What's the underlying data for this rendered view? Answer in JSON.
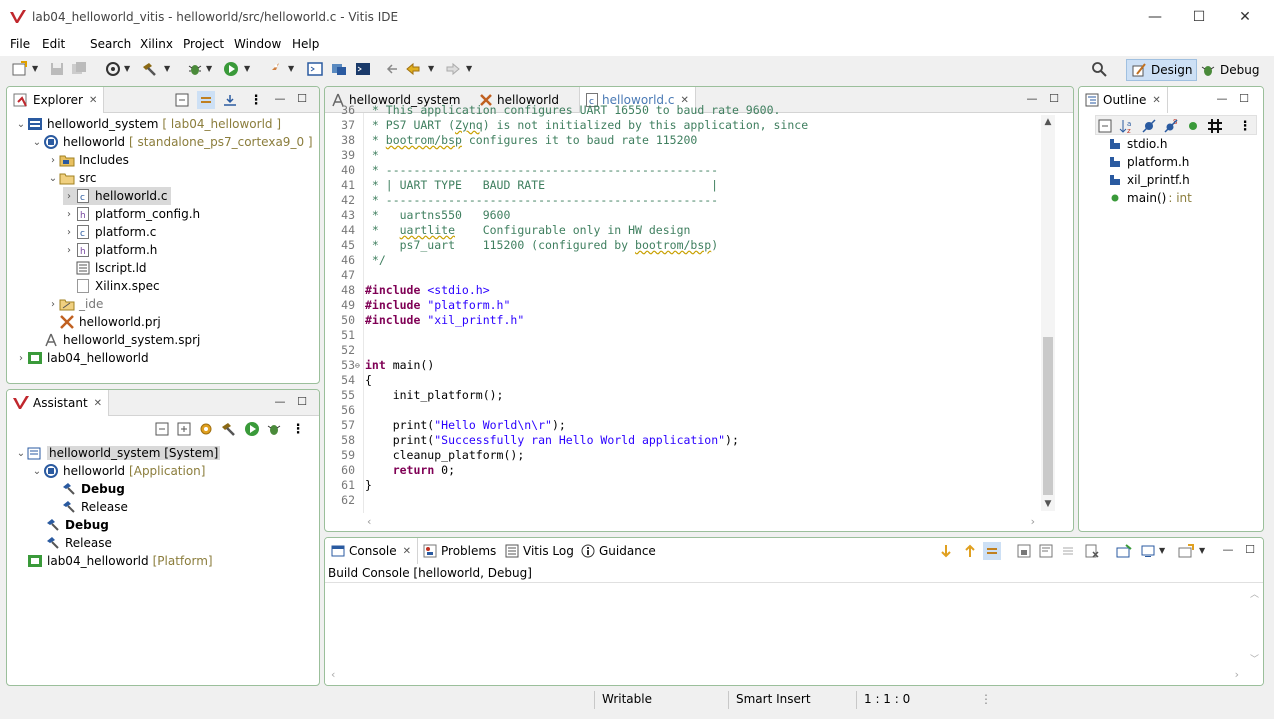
{
  "window": {
    "title": "lab04_helloworld_vitis - helloworld/src/helloworld.c - Vitis IDE",
    "minimize": "—",
    "maximize": "☐",
    "close": "✕"
  },
  "menu": [
    "File",
    "Edit",
    "Search",
    "Xilinx",
    "Project",
    "Window",
    "Help"
  ],
  "perspectives": {
    "design": "Design",
    "debug": "Debug"
  },
  "explorer": {
    "tab": "Explorer",
    "items": [
      {
        "label": "helloworld_system",
        "deco": "[ lab04_helloworld ]"
      },
      {
        "label": "helloworld",
        "deco": "[ standalone_ps7_cortexa9_0 ]"
      },
      {
        "label": "Includes"
      },
      {
        "label": "src"
      },
      {
        "label": "helloworld.c"
      },
      {
        "label": "platform_config.h"
      },
      {
        "label": "platform.c"
      },
      {
        "label": "platform.h"
      },
      {
        "label": "lscript.ld"
      },
      {
        "label": "Xilinx.spec"
      },
      {
        "label": "_ide"
      },
      {
        "label": "helloworld.prj"
      },
      {
        "label": "helloworld_system.sprj"
      },
      {
        "label": "lab04_helloworld"
      }
    ]
  },
  "assistant": {
    "tab": "Assistant",
    "items": [
      {
        "label": "helloworld_system [System]"
      },
      {
        "label": "helloworld",
        "deco": "[Application]"
      },
      {
        "label": "Debug"
      },
      {
        "label": "Release"
      },
      {
        "label": "Debug"
      },
      {
        "label": "Release"
      },
      {
        "label": "lab04_helloworld",
        "deco": "[Platform]"
      }
    ]
  },
  "editor": {
    "tabs": [
      "helloworld_system",
      "helloworld",
      "helloworld.c"
    ],
    "lines": [
      {
        "n": "36",
        "t": " * This application configures UART 16550 to baud rate 9600."
      },
      {
        "n": "37",
        "t": " * PS7 UART (Zynq) is not initialized by this application, since"
      },
      {
        "n": "38",
        "t": " * bootrom/bsp configures it to baud rate 115200"
      },
      {
        "n": "39",
        "t": " *"
      },
      {
        "n": "40",
        "t": " * ------------------------------------------------"
      },
      {
        "n": "41",
        "t": " * | UART TYPE   BAUD RATE                        |"
      },
      {
        "n": "42",
        "t": " * ------------------------------------------------"
      },
      {
        "n": "43",
        "t": " *   uartns550   9600"
      },
      {
        "n": "44",
        "t": " *   uartlite    Configurable only in HW design"
      },
      {
        "n": "45",
        "t": " *   ps7_uart    115200 (configured by bootrom/bsp)"
      },
      {
        "n": "46",
        "t": " */"
      },
      {
        "n": "47",
        "t": ""
      },
      {
        "n": "48",
        "t": "#include <stdio.h>"
      },
      {
        "n": "49",
        "t": "#include \"platform.h\""
      },
      {
        "n": "50",
        "t": "#include \"xil_printf.h\""
      },
      {
        "n": "51",
        "t": ""
      },
      {
        "n": "52",
        "t": ""
      },
      {
        "n": "53",
        "t": "int main()"
      },
      {
        "n": "54",
        "t": "{"
      },
      {
        "n": "55",
        "t": "    init_platform();"
      },
      {
        "n": "56",
        "t": ""
      },
      {
        "n": "57",
        "t": "    print(\"Hello World\\n\\r\");"
      },
      {
        "n": "58",
        "t": "    print(\"Successfully ran Hello World application\");"
      },
      {
        "n": "59",
        "t": "    cleanup_platform();"
      },
      {
        "n": "60",
        "t": "    return 0;"
      },
      {
        "n": "61",
        "t": "}"
      },
      {
        "n": "62",
        "t": ""
      }
    ]
  },
  "outline": {
    "tab": "Outline",
    "items": [
      {
        "label": "stdio.h"
      },
      {
        "label": "platform.h"
      },
      {
        "label": "xil_printf.h"
      },
      {
        "label": "main()",
        "deco": ": int"
      }
    ]
  },
  "console": {
    "tabs": [
      "Console",
      "Problems",
      "Vitis Log",
      "Guidance"
    ],
    "title": "Build Console [helloworld, Debug]"
  },
  "status": {
    "writable": "Writable",
    "insert": "Smart Insert",
    "position": "1 : 1 : 0"
  },
  "colors": {
    "accent": "#9bbf9b",
    "selected_tab_text": "#4a7ab5"
  }
}
